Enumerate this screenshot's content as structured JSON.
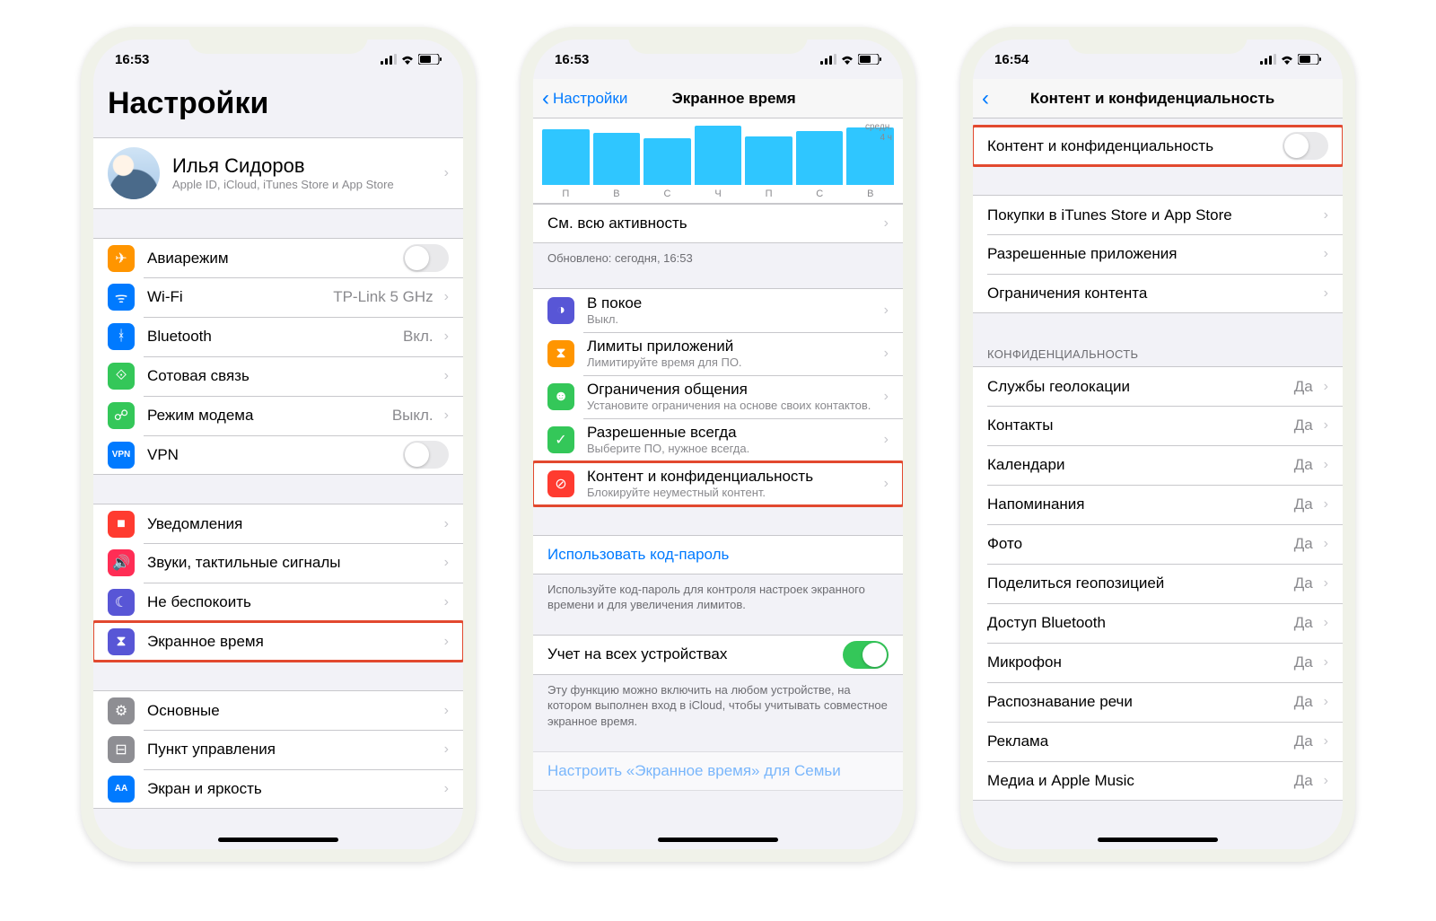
{
  "phone1": {
    "time": "16:53",
    "title": "Настройки",
    "profile": {
      "name": "Илья Сидоров",
      "sub": "Apple ID, iCloud, iTunes Store и App Store"
    },
    "g1": [
      {
        "key": "airplane",
        "label": "Авиарежим",
        "bg": "#ff9500",
        "toggle": "off"
      },
      {
        "key": "wifi",
        "label": "Wi-Fi",
        "value": "TP-Link 5 GHz",
        "bg": "#007aff"
      },
      {
        "key": "bluetooth",
        "label": "Bluetooth",
        "value": "Вкл.",
        "bg": "#007aff"
      },
      {
        "key": "cellular",
        "label": "Сотовая связь",
        "bg": "#34c759"
      },
      {
        "key": "hotspot",
        "label": "Режим модема",
        "value": "Выкл.",
        "bg": "#34c759"
      },
      {
        "key": "vpn",
        "label": "VPN",
        "bg": "#007aff",
        "badge": "VPN",
        "toggle": "off"
      }
    ],
    "g2": [
      {
        "key": "notifications",
        "label": "Уведомления",
        "bg": "#ff3b30"
      },
      {
        "key": "sounds",
        "label": "Звуки, тактильные сигналы",
        "bg": "#ff2d55"
      },
      {
        "key": "dnd",
        "label": "Не беспокоить",
        "bg": "#5856d6"
      },
      {
        "key": "screentime",
        "label": "Экранное время",
        "bg": "#5856d6",
        "hl": true
      }
    ],
    "g3": [
      {
        "key": "general",
        "label": "Основные",
        "bg": "#8e8e93"
      },
      {
        "key": "control",
        "label": "Пункт управления",
        "bg": "#8e8e93"
      },
      {
        "key": "display",
        "label": "Экран и яркость",
        "bg": "#007aff",
        "badge": "AA"
      }
    ]
  },
  "phone2": {
    "time": "16:53",
    "back": "Настройки",
    "title": "Экранное время",
    "chart": {
      "side_top": "средн.",
      "side_val": "4 ч",
      "days": [
        "П",
        "В",
        "С",
        "Ч",
        "П",
        "С",
        "В"
      ],
      "bars": [
        62,
        58,
        52,
        66,
        54,
        60,
        64
      ]
    },
    "activity": {
      "label": "См. всю активность",
      "sub": "Обновлено: сегодня, 16:53"
    },
    "items": [
      {
        "key": "downtime",
        "label": "В покое",
        "sub": "Выкл.",
        "bg": "#5856d6"
      },
      {
        "key": "applimits",
        "label": "Лимиты приложений",
        "sub": "Лимитируйте время для ПО.",
        "bg": "#ff9500"
      },
      {
        "key": "commlimits",
        "label": "Ограничения общения",
        "sub": "Установите ограничения на основе своих контактов.",
        "bg": "#34c759"
      },
      {
        "key": "allowed",
        "label": "Разрешенные всегда",
        "sub": "Выберите ПО, нужное всегда.",
        "bg": "#34c759"
      },
      {
        "key": "content",
        "label": "Контент и конфиденциальность",
        "sub": "Блокируйте неуместный контент.",
        "bg": "#ff3b30",
        "hl": true
      }
    ],
    "passcode": {
      "label": "Использовать код-пароль",
      "footer": "Используйте код-пароль для контроля настроек экранного времени и для увеличения лимитов."
    },
    "devices": {
      "label": "Учет на всех устройствах",
      "footer": "Эту функцию можно включить на любом устройстве, на котором выполнен вход в iCloud, чтобы учитывать совместное экранное время."
    },
    "family": "Настроить «Экранное время» для Семьи"
  },
  "phone3": {
    "time": "16:54",
    "title": "Контент и конфиденциальность",
    "master": {
      "label": "Контент и конфиденциальность"
    },
    "g1": [
      {
        "key": "purchases",
        "label": "Покупки в iTunes Store и App Store"
      },
      {
        "key": "allowedapps",
        "label": "Разрешенные приложения"
      },
      {
        "key": "restrictions",
        "label": "Ограничения контента"
      }
    ],
    "privHeader": "КОНФИДЕНЦИАЛЬНОСТЬ",
    "priv": [
      {
        "key": "location",
        "label": "Службы геолокации",
        "value": "Да"
      },
      {
        "key": "contacts",
        "label": "Контакты",
        "value": "Да"
      },
      {
        "key": "calendars",
        "label": "Календари",
        "value": "Да"
      },
      {
        "key": "reminders",
        "label": "Напоминания",
        "value": "Да"
      },
      {
        "key": "photos",
        "label": "Фото",
        "value": "Да"
      },
      {
        "key": "sharelocation",
        "label": "Поделиться геопозицией",
        "value": "Да"
      },
      {
        "key": "btaccess",
        "label": "Доступ Bluetooth",
        "value": "Да"
      },
      {
        "key": "mic",
        "label": "Микрофон",
        "value": "Да"
      },
      {
        "key": "speech",
        "label": "Распознавание речи",
        "value": "Да"
      },
      {
        "key": "ads",
        "label": "Реклама",
        "value": "Да"
      },
      {
        "key": "media",
        "label": "Медиа и Apple Music",
        "value": "Да"
      }
    ]
  }
}
